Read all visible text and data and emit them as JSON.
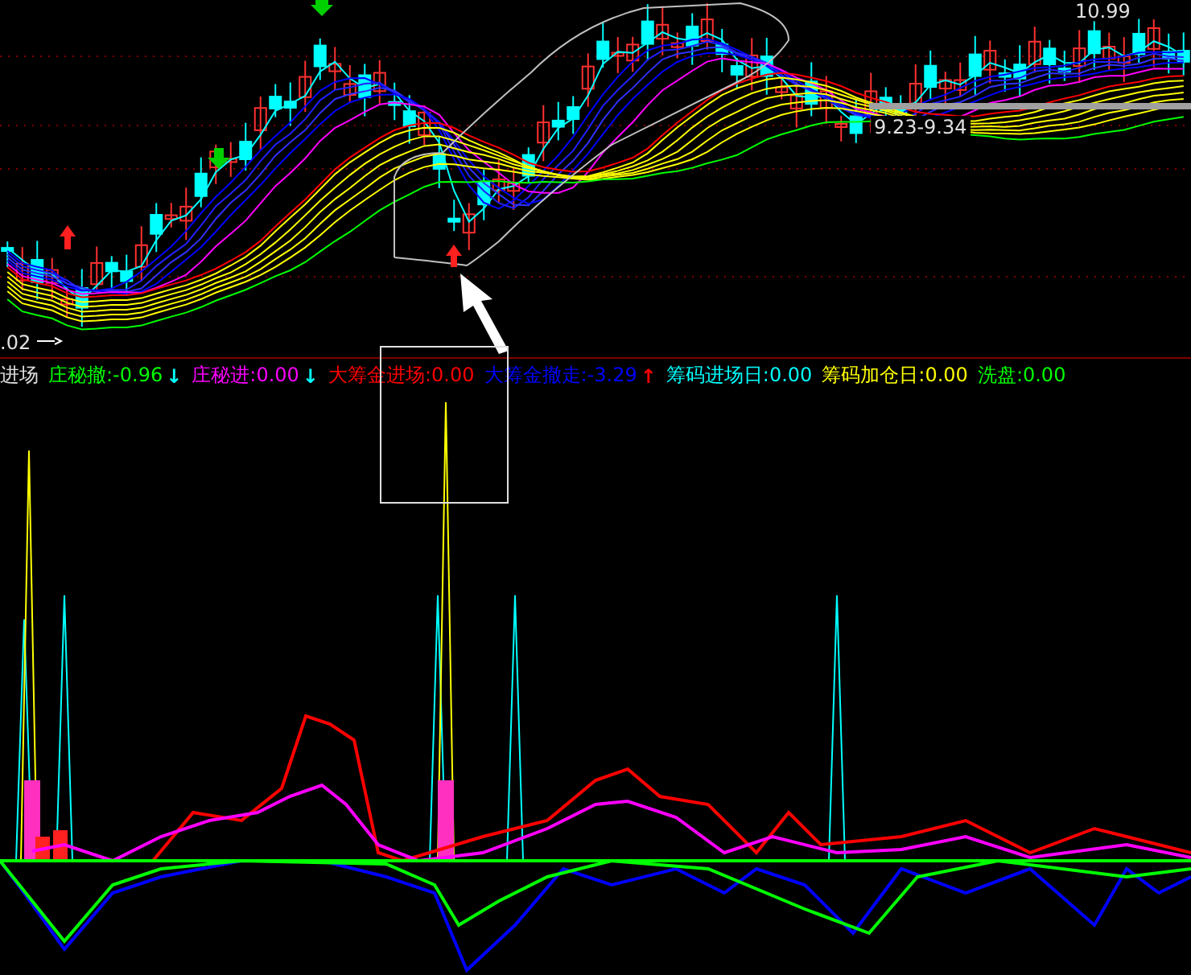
{
  "price_chart": {
    "labels": [
      {
        "text": "10.99",
        "kind": "high"
      },
      {
        "text": "9.23-9.34",
        "kind": "range"
      },
      {
        "text": ".02",
        "kind": "low"
      }
    ]
  },
  "indicator_legend": [
    {
      "text": "进场",
      "color": "#e0e0e0"
    },
    {
      "text": "庄秘撤:-0.96",
      "color": "#00ff00",
      "arrow": {
        "text": "↓",
        "color": "#00ffff"
      }
    },
    {
      "text": "庄秘进:0.00",
      "color": "#ff00ff",
      "arrow": {
        "text": "↓",
        "color": "#00ffff"
      }
    },
    {
      "text": "大筹金进场:0.00",
      "color": "#ff0000"
    },
    {
      "text": "大筹金撤走:-3.29",
      "color": "#0000ff",
      "arrow": {
        "text": "↑",
        "color": "#ff0000"
      }
    },
    {
      "text": "筹码进场日:0.00",
      "color": "#00ffff"
    },
    {
      "text": "筹码加仓日:0.00",
      "color": "#ffff00"
    },
    {
      "text": "洗盘:0.00",
      "color": "#00ff00"
    }
  ]
}
